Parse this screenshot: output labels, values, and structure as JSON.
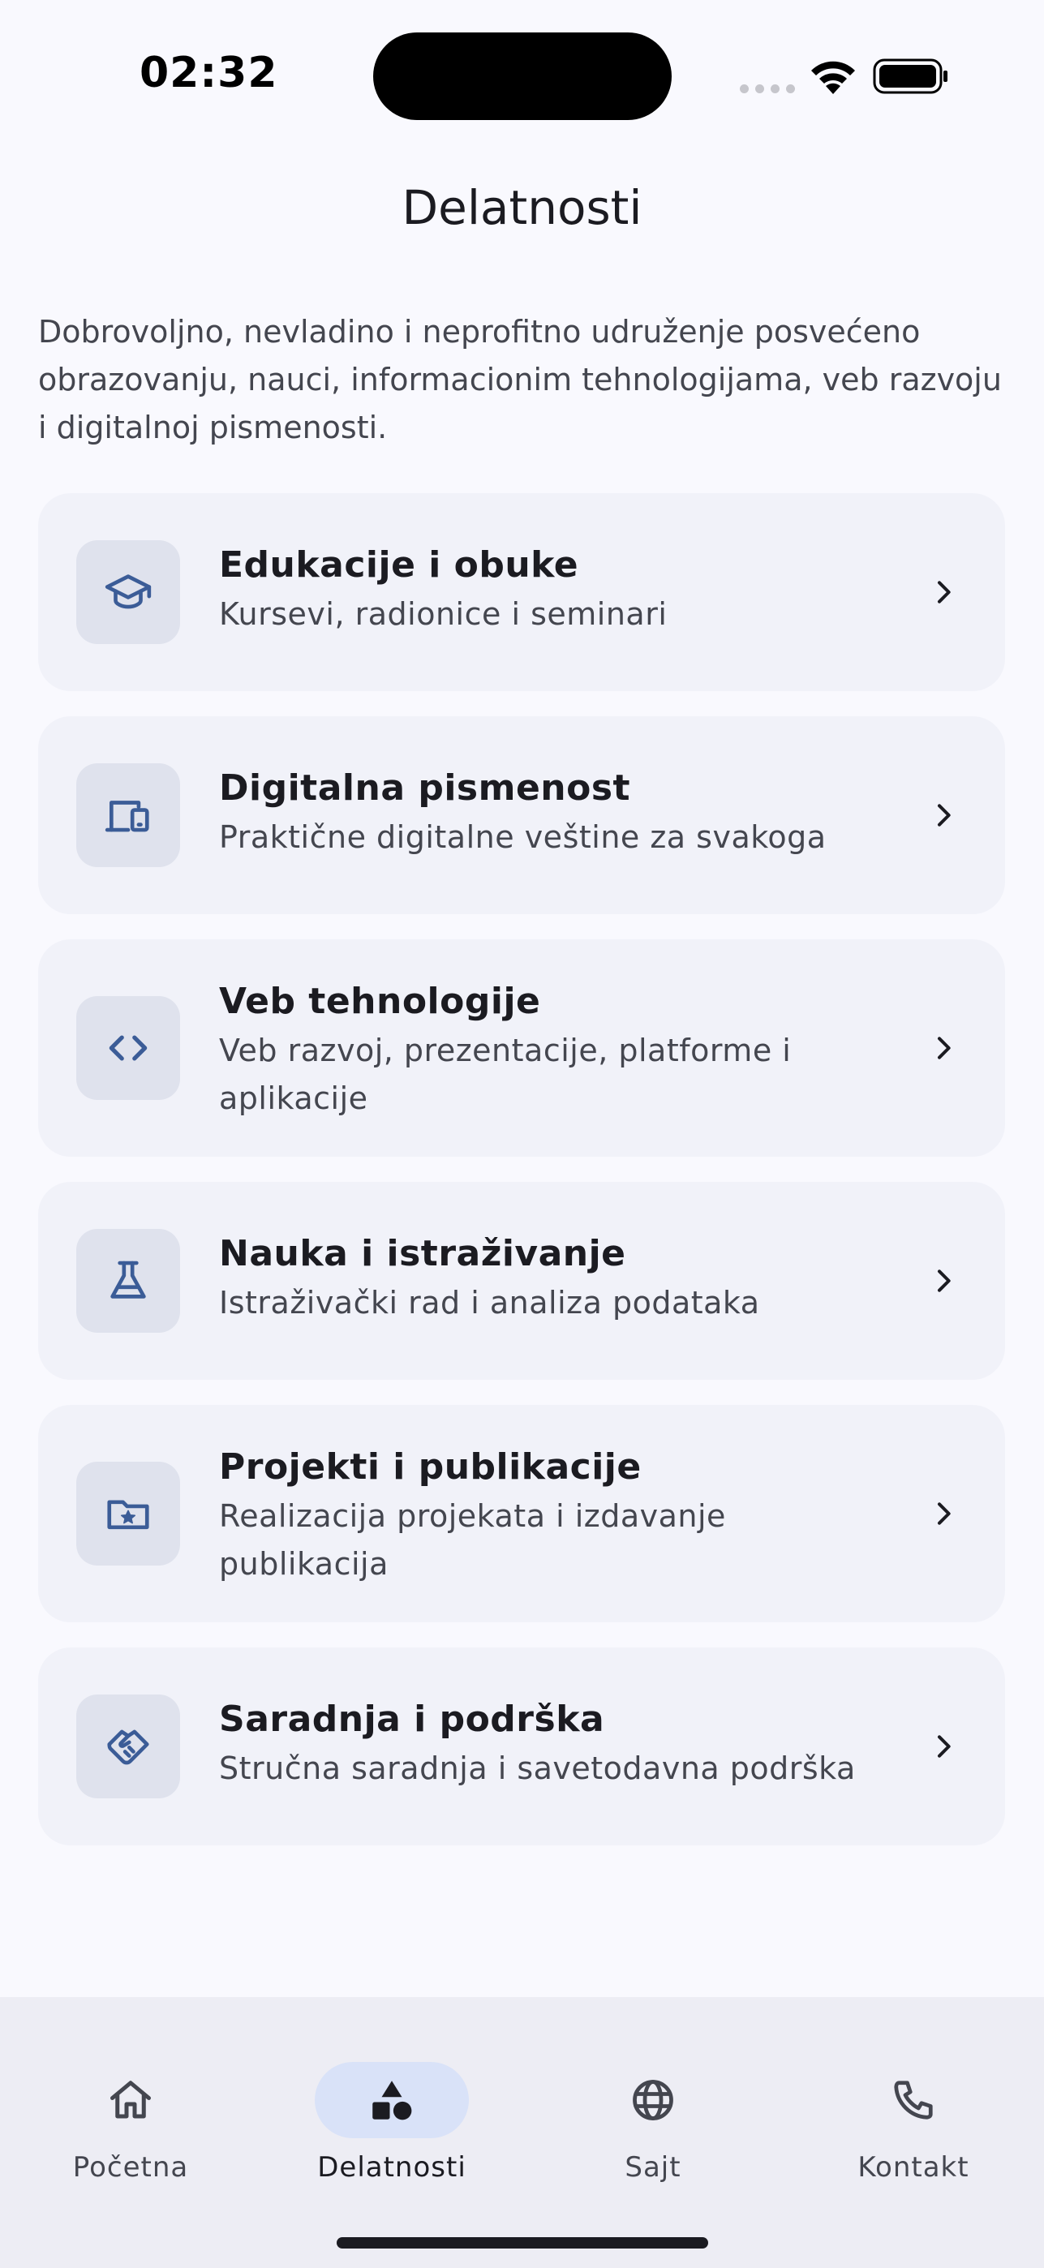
{
  "status_bar": {
    "time": "02:32"
  },
  "header": {
    "title": "Delatnosti"
  },
  "intro": "Dobrovoljno, nevladino i neprofitno udruženje posvećeno obrazovanju, nauci, informacionim tehnologijama, veb razvoju i digitalnoj pismenosti.",
  "colors": {
    "background": "#f9f9fe",
    "card": "#f1f2f9",
    "icon_box": "#dfe2ed",
    "icon": "#3b5c97",
    "nav_background": "#ededf4",
    "nav_active_indicator": "#d9e2f8"
  },
  "cards": [
    {
      "icon": "graduation-cap-icon",
      "title": "Edukacije i obuke",
      "subtitle": "Kursevi, radionice i seminari"
    },
    {
      "icon": "devices-icon",
      "title": "Digitalna pismenost",
      "subtitle": "Praktične digitalne veštine za svakoga"
    },
    {
      "icon": "code-icon",
      "title": "Veb tehnologije",
      "subtitle": "Veb razvoj, prezentacije, platforme i aplikacije"
    },
    {
      "icon": "flask-icon",
      "title": "Nauka i istraživanje",
      "subtitle": "Istraživački rad i analiza podataka"
    },
    {
      "icon": "folder-star-icon",
      "title": "Projekti i publikacije",
      "subtitle": "Realizacija projekata i izdavanje publikacija"
    },
    {
      "icon": "handshake-icon",
      "title": "Saradnja i podrška",
      "subtitle": "Stručna saradnja i savetodavna podrška"
    }
  ],
  "nav": {
    "active": "Delatnosti",
    "items": [
      {
        "icon": "home-icon",
        "label": "Početna"
      },
      {
        "icon": "category-icon",
        "label": "Delatnosti"
      },
      {
        "icon": "globe-icon",
        "label": "Sajt"
      },
      {
        "icon": "phone-icon",
        "label": "Kontakt"
      }
    ]
  }
}
